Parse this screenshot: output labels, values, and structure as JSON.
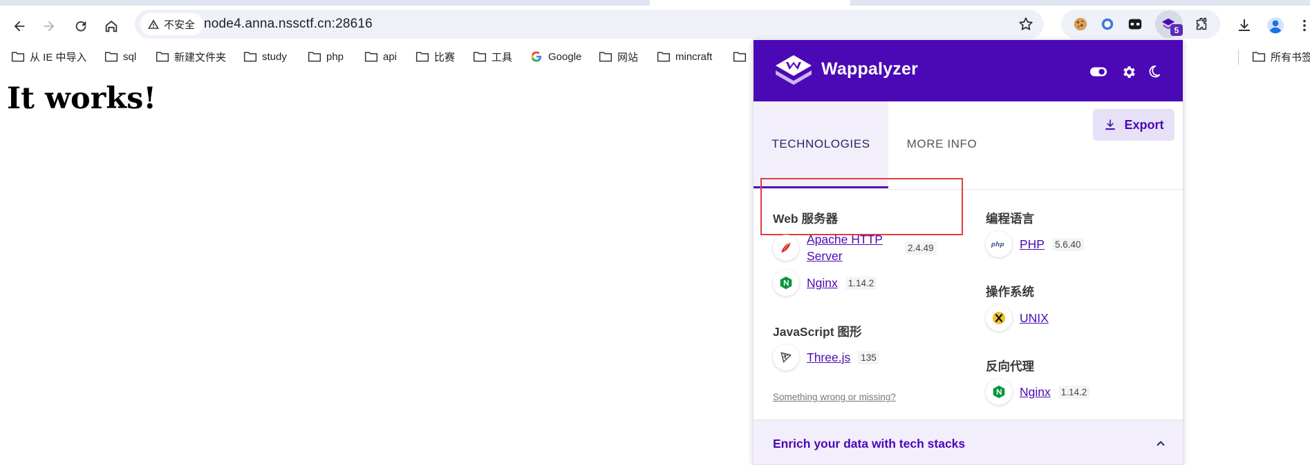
{
  "browser": {
    "url": "node4.anna.nssctf.cn:28616",
    "security_label": "不安全",
    "extension_badge": "5"
  },
  "bookmarks": [
    "从 IE 中导入",
    "sql",
    "新建文件夹",
    "study",
    "php",
    "api",
    "比赛",
    "工具",
    "Google",
    "网站",
    "mincraft",
    "所有书签"
  ],
  "page": {
    "heading": "It works!"
  },
  "wappalyzer": {
    "brand": "Wappalyzer",
    "tabs": {
      "technologies": "TECHNOLOGIES",
      "more_info": "MORE INFO"
    },
    "export_label": "Export",
    "categories": {
      "web_server": {
        "title": "Web 服务器",
        "items": [
          {
            "name_line1": "Apache HTTP",
            "name_line2": "Server",
            "version": "2.4.49"
          },
          {
            "name": "Nginx",
            "version": "1.14.2"
          }
        ]
      },
      "javascript_graphics": {
        "title": "JavaScript 图形",
        "items": [
          {
            "name": "Three.js",
            "version": "135"
          }
        ]
      },
      "programming_language": {
        "title": "编程语言",
        "items": [
          {
            "name": "PHP",
            "version": "5.6.40"
          }
        ]
      },
      "os": {
        "title": "操作系统",
        "items": [
          {
            "name": "UNIX"
          }
        ]
      },
      "reverse_proxy": {
        "title": "反向代理",
        "items": [
          {
            "name": "Nginx",
            "version": "1.14.2"
          }
        ]
      }
    },
    "report_link": "Something wrong or missing?",
    "enrich_label": "Enrich your data with tech stacks"
  },
  "colors": {
    "brand_purple": "#4b08b5",
    "highlight_red": "#e23c3c"
  }
}
